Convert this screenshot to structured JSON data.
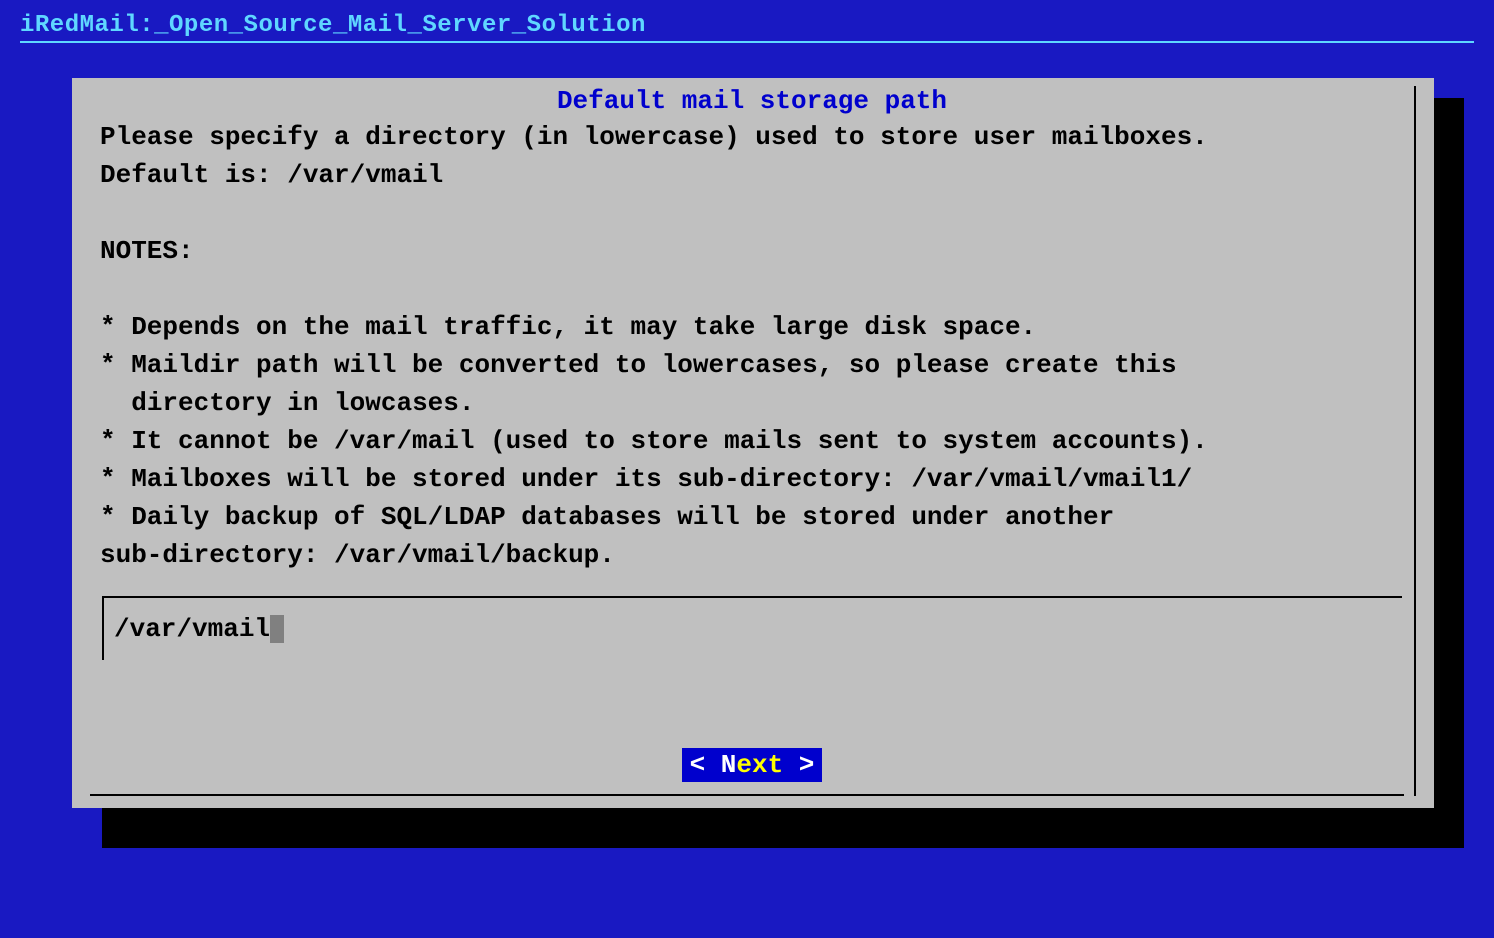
{
  "app": {
    "title": "iRedMail:_Open_Source_Mail_Server_Solution"
  },
  "dialog": {
    "title": "Default mail storage path",
    "body": "Please specify a directory (in lowercase) used to store user mailboxes.\nDefault is: /var/vmail\n\nNOTES:\n\n* Depends on the mail traffic, it may take large disk space.\n* Maildir path will be converted to lowercases, so please create this\n  directory in lowcases.\n* It cannot be /var/mail (used to store mails sent to system accounts).\n* Mailboxes will be stored under its sub-directory: /var/vmail/vmail1/\n* Daily backup of SQL/LDAP databases will be stored under another\nsub-directory: /var/vmail/backup.",
    "input_value": "/var/vmail"
  },
  "buttons": {
    "next_prefix": "< ",
    "next_hotkey_first": "N",
    "next_hotkey_rest": "ext",
    "next_suffix": " >"
  }
}
